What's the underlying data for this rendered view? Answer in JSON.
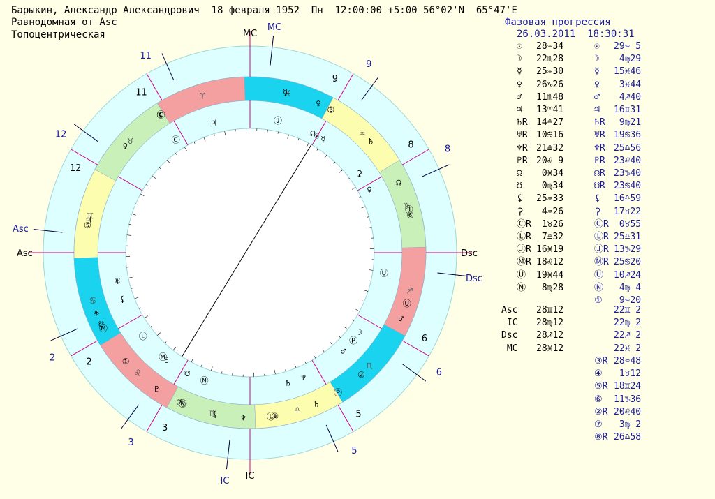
{
  "header": {
    "line1": "Барыкин, Александр Александрович  18 февраля 1952  Пн  12:00:00 +5:00 56°02'N  65°47'E",
    "line2": "Равнодомная от Asc",
    "line3": "Топоцентрическая"
  },
  "progression": {
    "title": "Фазовая прогрессия",
    "date": "26.03.2011  18:30:31"
  },
  "planets": [
    {
      "sym": "☉",
      "nat": "28♒34",
      "ps": "☉",
      "prog": "29♒ 5"
    },
    {
      "sym": "☽",
      "nat": "22♏28",
      "ps": "☽",
      "prog": " 4♍29"
    },
    {
      "sym": "☿",
      "nat": "25♒30",
      "ps": "☿",
      "prog": "15♓46"
    },
    {
      "sym": "♀",
      "nat": "26♑26",
      "ps": "♀",
      "prog": " 3♓44"
    },
    {
      "sym": "♂",
      "nat": "11♏48",
      "ps": "♂",
      "prog": " 4♐40"
    },
    {
      "sym": "♃",
      "nat": "13♈41",
      "ps": "♃",
      "prog": "16♊31"
    },
    {
      "sym": "♄R",
      "nat": "14♎27",
      "ps": "♄R",
      "prog": " 9♍21"
    },
    {
      "sym": "♅R",
      "nat": "10♋16",
      "ps": "♅R",
      "prog": "19♋36"
    },
    {
      "sym": "♆R",
      "nat": "21♎32",
      "ps": "♆R",
      "prog": "25♎56"
    },
    {
      "sym": "♇R",
      "nat": "20♌ 9",
      "ps": "♇R",
      "prog": "23♌40"
    },
    {
      "sym": "☊",
      "nat": " 0♓34",
      "ps": "☊R",
      "prog": "23♑40"
    },
    {
      "sym": "☋",
      "nat": " 0♍34",
      "ps": "☋R",
      "prog": "23♋40"
    },
    {
      "sym": "⚸",
      "nat": "25♒33",
      "ps": "⚸",
      "prog": "16♎59"
    },
    {
      "sym": "⚳",
      "nat": " 4♒26",
      "ps": "⚳",
      "prog": "17♉22"
    },
    {
      "sym": "ⒸR",
      "nat": " 1♉26",
      "ps": "ⒸR",
      "prog": " 0♉55"
    },
    {
      "sym": "ⓁR",
      "nat": " 7♎32",
      "ps": "ⓁR",
      "prog": "25♎31"
    },
    {
      "sym": "ⒿR",
      "nat": "16♓19",
      "ps": "ⒿR",
      "prog": "13♑29"
    },
    {
      "sym": "ⓂR",
      "nat": "18♌12",
      "ps": "ⓂR",
      "prog": "25♋20"
    },
    {
      "sym": "Ⓤ",
      "nat": "19♓44",
      "ps": "Ⓤ",
      "prog": "10♐24"
    },
    {
      "sym": "Ⓝ",
      "nat": " 8♍28",
      "ps": "Ⓝ",
      "prog": " 4♍ 4"
    },
    {
      "sym": "",
      "nat": "",
      "ps": "①",
      "prog": " 9♒20"
    }
  ],
  "angles": [
    {
      "name": "Asc",
      "nat": "28♊12",
      "prog": "22♊ 2"
    },
    {
      "name": " IC",
      "nat": "28♍12",
      "prog": "22♍ 2"
    },
    {
      "name": "Dsc",
      "nat": "28♐12",
      "prog": "22♐ 2"
    },
    {
      "name": " MC",
      "nat": "28♓12",
      "prog": "22♓ 2"
    }
  ],
  "extra": [
    {
      "sym": "③R",
      "prog": "28♒48"
    },
    {
      "sym": "④",
      "prog": " 1♉12"
    },
    {
      "sym": "⑤R",
      "prog": "18♊24"
    },
    {
      "sym": "⑥",
      "prog": "11♑36"
    },
    {
      "sym": "②R",
      "prog": "20♌40"
    },
    {
      "sym": "⑦",
      "prog": " 3♍ 2"
    },
    {
      "sym": "⑧R",
      "prog": "26♎58"
    }
  ],
  "chart_labels": {
    "mc_black": "MC",
    "mc_blue": "MC",
    "ic_black": "IC",
    "ic_blue": "IC",
    "asc_black": "Asc",
    "asc_blue": "Asc",
    "dsc_black": "Dsc",
    "dsc_blue": "Dsc"
  },
  "house_numbers_black": [
    "11",
    "12",
    "2",
    "3",
    "5",
    "6",
    "8",
    "9"
  ],
  "house_numbers_blue": [
    "11",
    "12",
    "2",
    "3",
    "5",
    "6",
    "8",
    "9"
  ],
  "signs": [
    "♈",
    "♉",
    "♊",
    "♋",
    "♌",
    "♍",
    "♎",
    "♏",
    "♐",
    "♑",
    "♒",
    "♓"
  ],
  "sign_colors": [
    "#f4a0a0",
    "#c8f0b8",
    "#fdfdb0",
    "#1ad3ee"
  ],
  "colors": {
    "bg": "#ffffe8",
    "ring": "#ddffff",
    "ring_line": "#9ed6d6",
    "house": "#d0008c",
    "blue": "#1a1a9a"
  },
  "natal_glyphs": [
    {
      "g": "☉",
      "lon": 328.57
    },
    {
      "g": "☿",
      "lon": 325.5
    },
    {
      "g": "☊",
      "lon": 330.57
    },
    {
      "g": "Ⓙ",
      "lon": 346.3
    },
    {
      "g": "♃",
      "lon": 13.7
    },
    {
      "g": "Ⓒ",
      "lon": 31.4
    },
    {
      "g": "♅",
      "lon": 100.3
    },
    {
      "g": "⚸",
      "lon": 108
    },
    {
      "g": "Ⓛ",
      "lon": 126
    },
    {
      "g": "Ⓜ",
      "lon": 138.2
    },
    {
      "g": "♇",
      "lon": 140.2
    },
    {
      "g": "☋",
      "lon": 150.6
    },
    {
      "g": "Ⓝ",
      "lon": 158.5
    },
    {
      "g": "♄",
      "lon": 194.5
    },
    {
      "g": "♆",
      "lon": 201.5
    },
    {
      "g": "Ⓟ",
      "lon": 228
    },
    {
      "g": "♂",
      "lon": 221.8
    },
    {
      "g": "☽",
      "lon": 232.5
    },
    {
      "g": "Ⓤ",
      "lon": 259.7
    },
    {
      "g": "♀",
      "lon": 296.4
    },
    {
      "g": "⚳",
      "lon": 304.4
    }
  ],
  "prog_glyphs": [
    {
      "g": "☿",
      "lon": 345.8
    },
    {
      "g": "♀",
      "lon": 333.7
    },
    {
      "g": "③",
      "lon": 328.8
    },
    {
      "g": "☉",
      "lon": 329.1
    },
    {
      "g": "♄",
      "lon": 311
    },
    {
      "g": "☊",
      "lon": 293.7
    },
    {
      "g": "Ⓙ",
      "lon": 283.5
    },
    {
      "g": "⑥",
      "lon": 281.6
    },
    {
      "g": "Ⓤ",
      "lon": 250.4
    },
    {
      "g": "♂",
      "lon": 244.7
    },
    {
      "g": "②",
      "lon": 220.7
    },
    {
      "g": "Ⓟ",
      "lon": 210.5
    },
    {
      "g": "♄",
      "lon": 202
    },
    {
      "g": "♆",
      "lon": 175.9
    },
    {
      "g": "Ⓛ",
      "lon": 185.5
    },
    {
      "g": "⑧",
      "lon": 186.9
    },
    {
      "g": "⚸",
      "lon": 166
    },
    {
      "g": "Ⓝ",
      "lon": 154.1
    },
    {
      "g": "☽",
      "lon": 154.5
    },
    {
      "g": "⑦",
      "lon": 153
    },
    {
      "g": "♇",
      "lon": 143.7
    },
    {
      "g": "①",
      "lon": 129.3
    },
    {
      "g": "☋",
      "lon": 113.7
    },
    {
      "g": "Ⓜ",
      "lon": 115.3
    },
    {
      "g": "♅",
      "lon": 109.6
    },
    {
      "g": "⑤",
      "lon": 78.4
    },
    {
      "g": "♃",
      "lon": 76.5
    },
    {
      "g": "④",
      "lon": 31.2
    },
    {
      "g": "Ⓒ",
      "lon": 30.9
    },
    {
      "g": "♀",
      "lon": 47.4
    }
  ]
}
